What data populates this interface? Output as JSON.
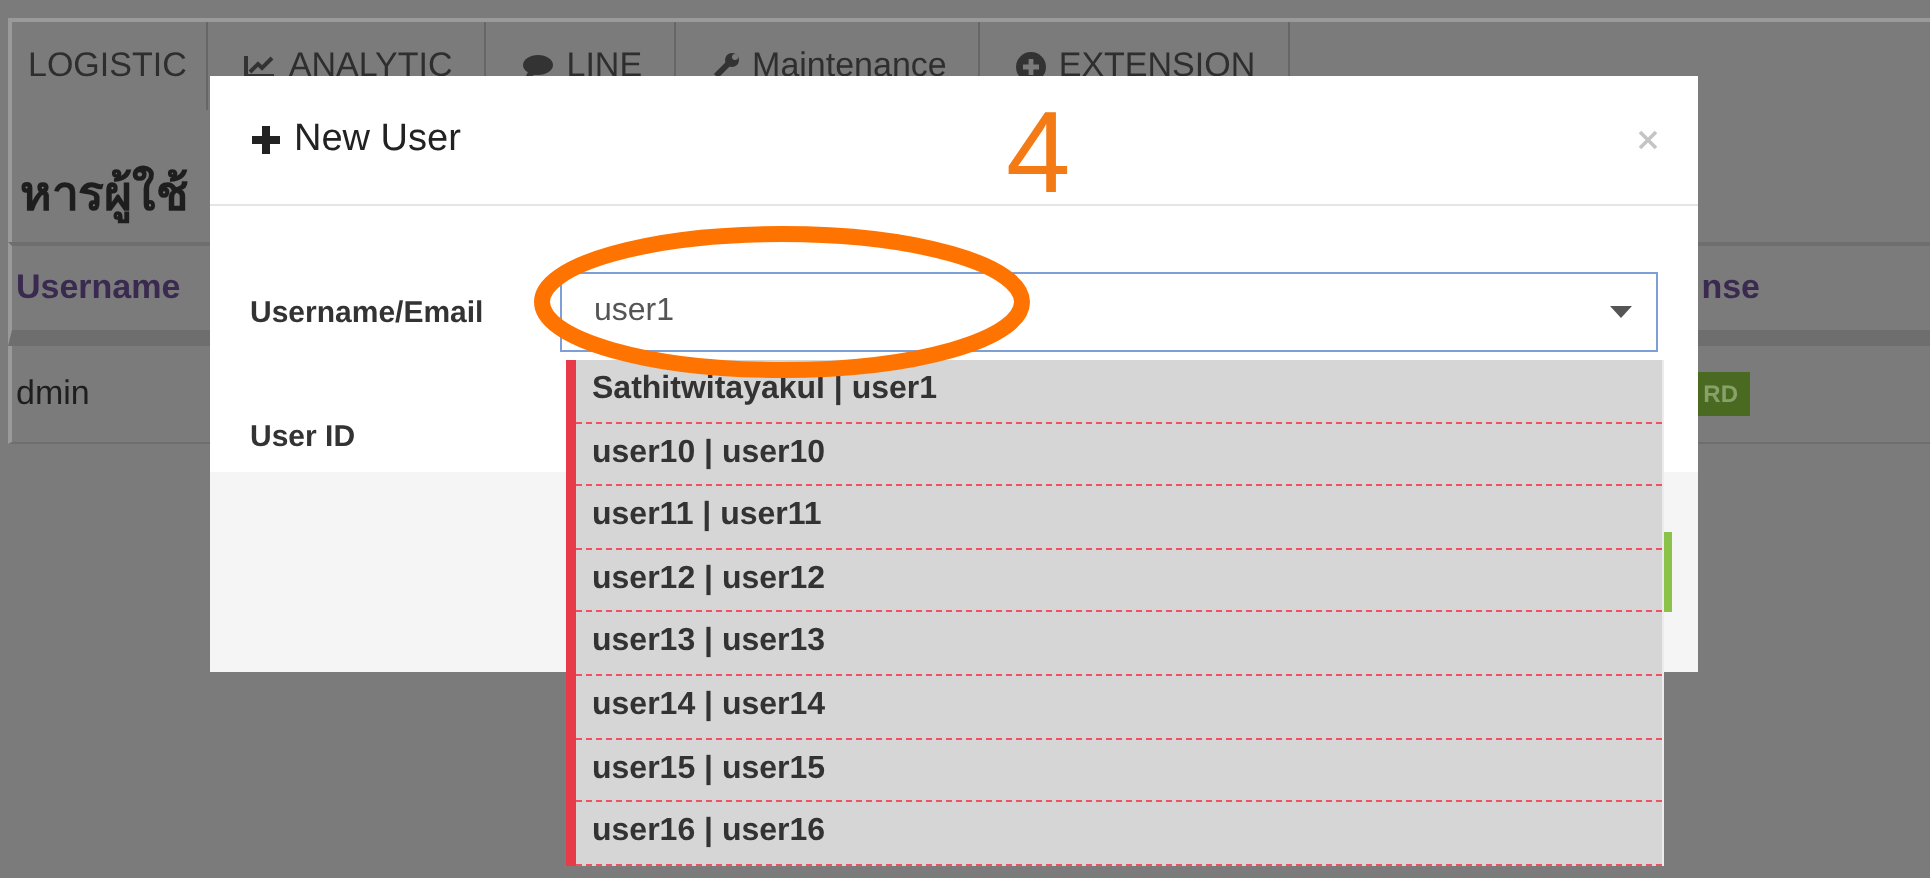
{
  "nav": {
    "tabs": [
      {
        "label": "LOGISTIC",
        "kind": "text"
      },
      {
        "label": "ANALYTIC",
        "kind": "chart"
      },
      {
        "label": "LINE",
        "kind": "comment"
      },
      {
        "label": "Maintenance",
        "kind": "wrench"
      },
      {
        "label": "EXTENSION",
        "kind": "add"
      }
    ]
  },
  "page": {
    "heading": "หารผู้ใช้",
    "table": {
      "columns": [
        "Username",
        "nse"
      ],
      "rows": [
        {
          "cells": [
            "dmin"
          ],
          "badge": "RD"
        }
      ]
    }
  },
  "modal": {
    "title": "New User",
    "fields": [
      {
        "label": "Username/Email",
        "value": "user1"
      },
      {
        "label": "User ID"
      }
    ],
    "dropdown": {
      "options": [
        {
          "label": "Sathitwitayakul | user1"
        },
        {
          "label": "user10 | user10"
        },
        {
          "label": "user11 | user11"
        },
        {
          "label": "user12 | user12"
        },
        {
          "label": "user13 | user13"
        },
        {
          "label": "user14 | user14"
        },
        {
          "label": "user15 | user15"
        },
        {
          "label": "user16 | user16"
        }
      ]
    }
  },
  "annotation": {
    "step": "4"
  }
}
